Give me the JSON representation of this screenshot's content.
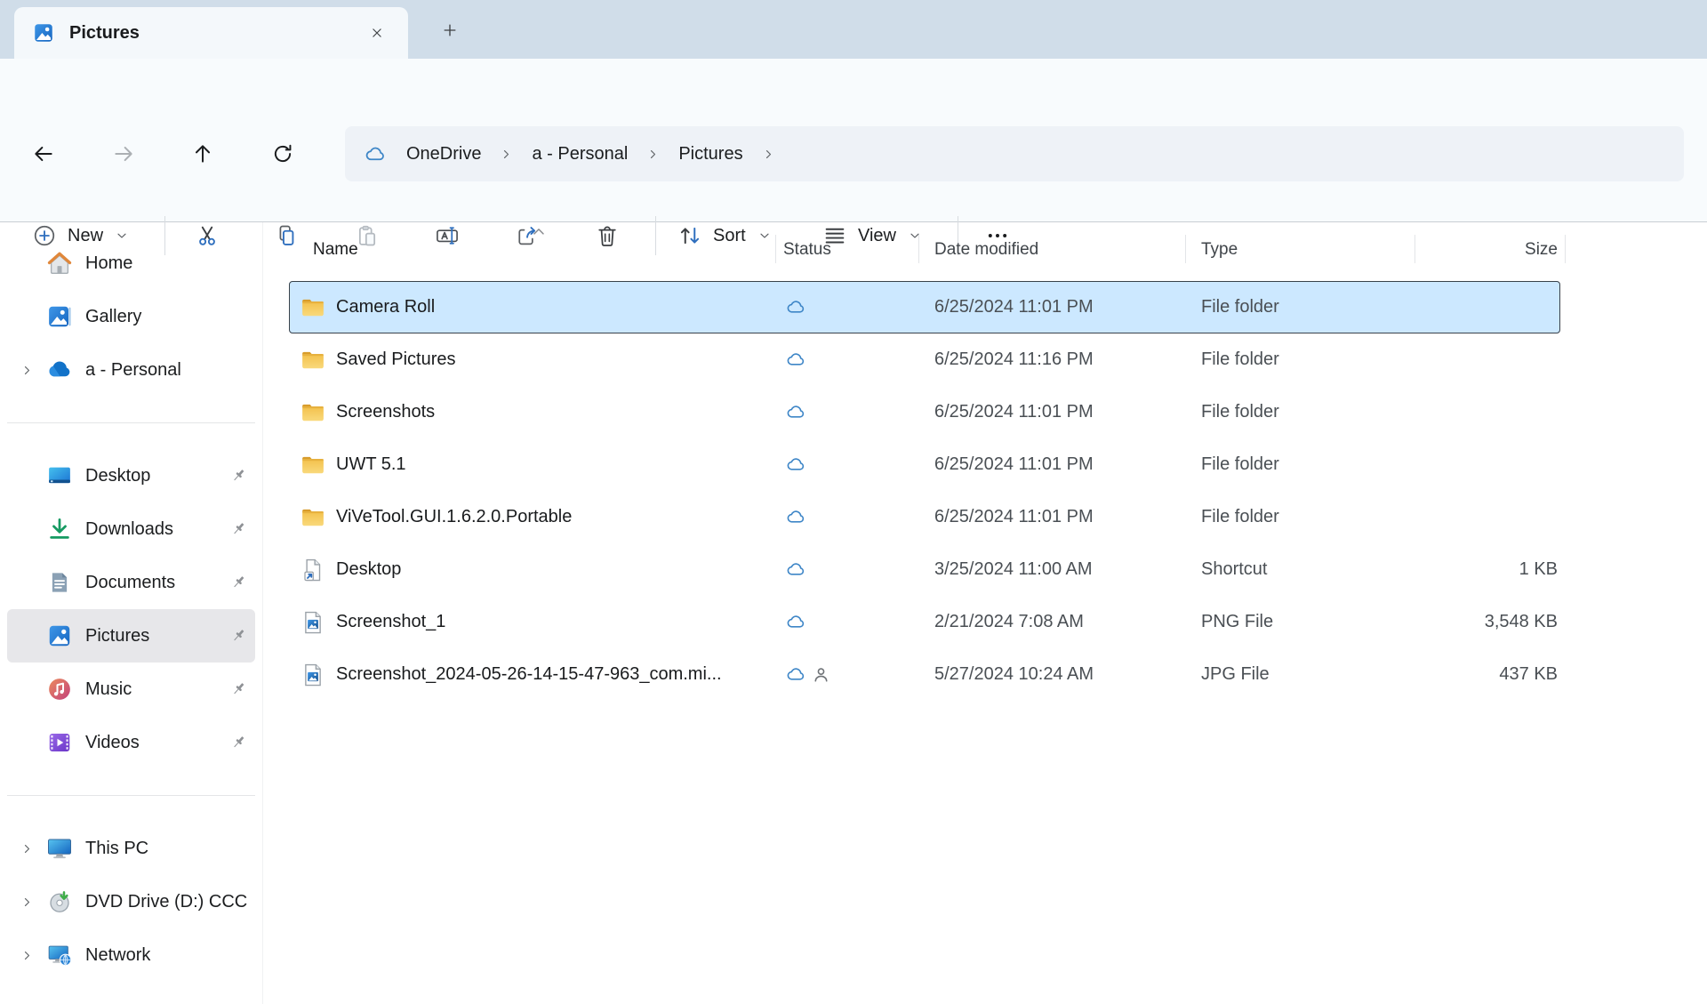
{
  "tab": {
    "title": "Pictures"
  },
  "breadcrumb": {
    "items": [
      "OneDrive",
      "a - Personal",
      "Pictures"
    ]
  },
  "toolbar": {
    "new_label": "New",
    "sort_label": "Sort",
    "view_label": "View"
  },
  "columns": {
    "name": "Name",
    "status": "Status",
    "date": "Date modified",
    "type": "Type",
    "size": "Size"
  },
  "sort": {
    "column": "Name",
    "direction": "ascending"
  },
  "sidebar": {
    "groups": [
      {
        "items": [
          {
            "label": "Home",
            "icon": "home",
            "chevron": false,
            "pin": false,
            "selected": false
          },
          {
            "label": "Gallery",
            "icon": "gallery",
            "chevron": false,
            "pin": false,
            "selected": false
          },
          {
            "label": "a - Personal",
            "icon": "onedrive",
            "chevron": true,
            "pin": false,
            "selected": false
          }
        ]
      },
      {
        "items": [
          {
            "label": "Desktop",
            "icon": "desktop",
            "chevron": false,
            "pin": true,
            "selected": false
          },
          {
            "label": "Downloads",
            "icon": "downloads",
            "chevron": false,
            "pin": true,
            "selected": false
          },
          {
            "label": "Documents",
            "icon": "documents",
            "chevron": false,
            "pin": true,
            "selected": false
          },
          {
            "label": "Pictures",
            "icon": "pictures",
            "chevron": false,
            "pin": true,
            "selected": true
          },
          {
            "label": "Music",
            "icon": "music",
            "chevron": false,
            "pin": true,
            "selected": false
          },
          {
            "label": "Videos",
            "icon": "videos",
            "chevron": false,
            "pin": true,
            "selected": false
          }
        ]
      },
      {
        "items": [
          {
            "label": "This PC",
            "icon": "thispc",
            "chevron": true,
            "pin": false,
            "selected": false
          },
          {
            "label": "DVD Drive (D:) CCC",
            "icon": "dvd",
            "chevron": true,
            "pin": false,
            "selected": false
          },
          {
            "label": "Network",
            "icon": "network",
            "chevron": true,
            "pin": false,
            "selected": false
          }
        ]
      }
    ]
  },
  "files": {
    "rows": [
      {
        "name": "Camera Roll",
        "icon": "folder",
        "status": "cloud",
        "date": "6/25/2024 11:01 PM",
        "type": "File folder",
        "size": "",
        "selected": true
      },
      {
        "name": "Saved Pictures",
        "icon": "folder",
        "status": "cloud",
        "date": "6/25/2024 11:16 PM",
        "type": "File folder",
        "size": "",
        "selected": false
      },
      {
        "name": "Screenshots",
        "icon": "folder",
        "status": "cloud",
        "date": "6/25/2024 11:01 PM",
        "type": "File folder",
        "size": "",
        "selected": false
      },
      {
        "name": "UWT 5.1",
        "icon": "folder",
        "status": "cloud",
        "date": "6/25/2024 11:01 PM",
        "type": "File folder",
        "size": "",
        "selected": false
      },
      {
        "name": "ViVeTool.GUI.1.6.2.0.Portable",
        "icon": "folder",
        "status": "cloud",
        "date": "6/25/2024 11:01 PM",
        "type": "File folder",
        "size": "",
        "selected": false
      },
      {
        "name": "Desktop",
        "icon": "shortcut",
        "status": "cloud",
        "date": "3/25/2024 11:00 AM",
        "type": "Shortcut",
        "size": "1 KB",
        "selected": false
      },
      {
        "name": "Screenshot_1",
        "icon": "image",
        "status": "cloud",
        "date": "2/21/2024 7:08 AM",
        "type": "PNG File",
        "size": "3,548 KB",
        "selected": false
      },
      {
        "name": "Screenshot_2024-05-26-14-15-47-963_com.mi...",
        "icon": "image",
        "status": "cloud-shared",
        "date": "5/27/2024 10:24 AM",
        "type": "JPG File",
        "size": "437 KB",
        "selected": false
      }
    ]
  },
  "colors": {
    "accent": "#2f6fbe",
    "tabbar_background": "#d0dde9",
    "selection_fill": "#cce8ff",
    "folder_yellow": "#f6c74c",
    "status_cloud_blue": "#3e86c7"
  }
}
